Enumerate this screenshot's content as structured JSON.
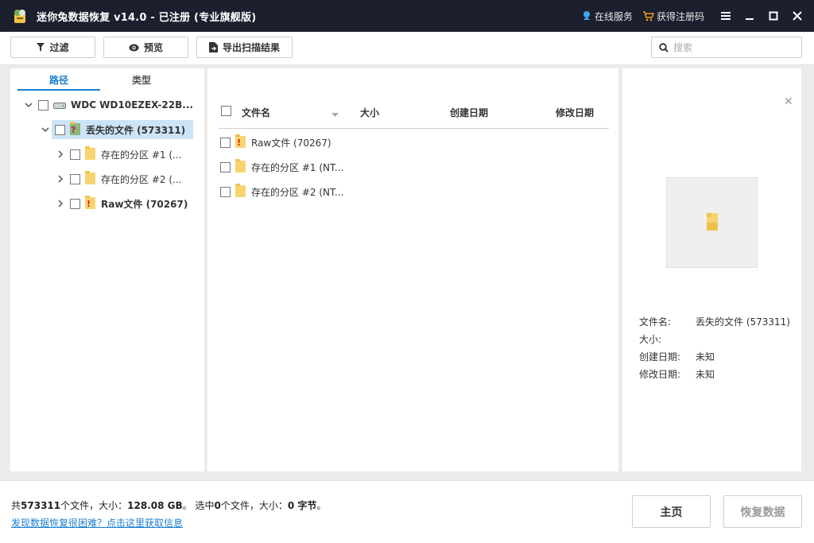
{
  "titlebar": {
    "title": "迷你兔数据恢复 v14.0 - 已注册 (专业旗舰版)",
    "online_service": "在线服务",
    "get_code": "获得注册码"
  },
  "toolbar": {
    "filter_label": "过滤",
    "preview_label": "预览",
    "export_label": "导出扫描结果",
    "search_placeholder": "搜索"
  },
  "left_panel": {
    "tabs": [
      "路径",
      "类型"
    ],
    "tree": [
      {
        "label": "WDC WD10EZEX-22B...",
        "icon": "hard-drive-icon"
      },
      {
        "label": "丢失的文件 (573311)",
        "icon": "lost-folder-icon"
      },
      {
        "label": "存在的分区 #1 (...",
        "icon": "folder-icon"
      },
      {
        "label": "存在的分区 #2 (...",
        "icon": "folder-icon"
      },
      {
        "label": "Raw文件 (70267)",
        "icon": "raw-folder-icon"
      }
    ]
  },
  "file_list": {
    "columns": [
      "文件名",
      "大小",
      "创建日期",
      "修改日期"
    ],
    "rows": [
      {
        "name": "Raw文件 (70267)",
        "icon": "raw-folder-icon"
      },
      {
        "name": "存在的分区 #1 (NT...",
        "icon": "folder-icon"
      },
      {
        "name": "存在的分区 #2 (NT...",
        "icon": "folder-icon"
      }
    ]
  },
  "preview": {
    "labels": [
      "文件名:",
      "大小:",
      "创建日期:",
      "修改日期:"
    ],
    "values": [
      "丢失的文件 (573311)",
      "",
      "未知",
      "未知"
    ]
  },
  "status": {
    "prefix": "共",
    "total_files": "573311",
    "files_unit": "个文件，大小：",
    "total_size": "128.08 GB",
    "selected_prefix": "。 选中",
    "selected_count": "0",
    "selected_mid": "个文件，大小：",
    "selected_size": "0 字节",
    "suffix": "。",
    "help_link": "发现数据恢复很困难？点击这里获取信息"
  },
  "actions": {
    "home_label": "主页",
    "recover_label": "恢复数据"
  },
  "colors": {
    "titlebar_bg": "#1b1f2e",
    "accent": "#1a7fd0",
    "selection_bg": "#cce4f7",
    "folder": "#f7d46f"
  }
}
